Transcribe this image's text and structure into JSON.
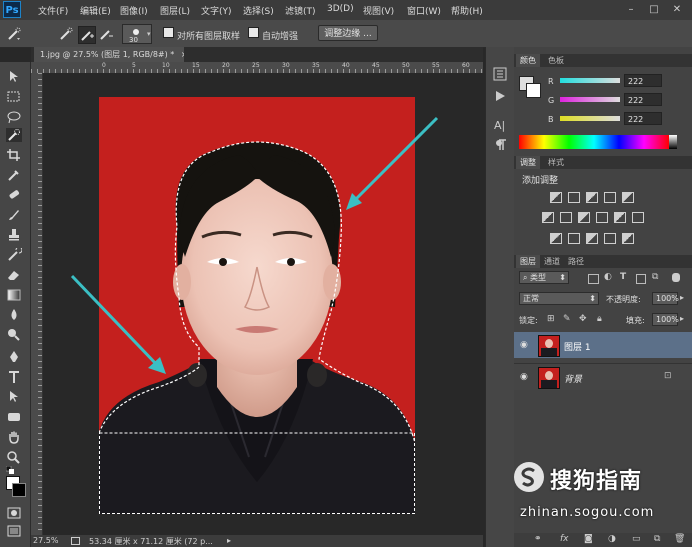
{
  "app": {
    "logo": "Ps",
    "menu": [
      "文件(F)",
      "编辑(E)",
      "图像(I)",
      "图层(L)",
      "文字(Y)",
      "选择(S)",
      "滤镜(T)",
      "3D(D)",
      "视图(V)",
      "窗口(W)",
      "帮助(H)"
    ],
    "window_controls": [
      "–",
      "□",
      "✕"
    ]
  },
  "options_bar": {
    "brush_size": "30",
    "sample_all_layers": "对所有图层取样",
    "auto_enhance": "自动增强",
    "refine_edge": "调整边缘 ..."
  },
  "document": {
    "tab_title": "1.jpg @ 27.5% (图层 1, RGB/8#) *",
    "tab_close": "×",
    "ruler_top_ticks": [
      "0",
      "5",
      "10",
      "15",
      "20",
      "25",
      "30",
      "35",
      "40",
      "45",
      "50",
      "55",
      "60"
    ],
    "zoom": "27.5%",
    "doc_info": "53.34 厘米 x 71.12 厘米 (72 p..."
  },
  "color_panel": {
    "tabs": [
      "颜色",
      "色板"
    ],
    "channels": [
      {
        "label": "R",
        "value": "222"
      },
      {
        "label": "G",
        "value": "222"
      },
      {
        "label": "B",
        "value": "222"
      }
    ],
    "foreground": "#dedede",
    "background": "#ffffff"
  },
  "adjustments_panel": {
    "tabs": [
      "调整",
      "样式"
    ],
    "title": "添加调整"
  },
  "layers_panel": {
    "tabs": [
      "图层",
      "通道",
      "路径"
    ],
    "filter_kind": "类型",
    "blend_mode": "正常",
    "opacity_label": "不透明度:",
    "opacity_value": "100%",
    "lock_label": "锁定:",
    "fill_label": "填充:",
    "fill_value": "100%",
    "layers": [
      {
        "name": "图层 1",
        "selected": true,
        "locked": false
      },
      {
        "name": "背景",
        "selected": false,
        "locked": true
      }
    ]
  },
  "watermark": {
    "text": "搜狗指南",
    "url": "zhinan.sogou.com"
  },
  "colors": {
    "photo_background": "#c4201e",
    "annotation_arrow": "#3bbfc4",
    "ps_blue": "#31a8ff"
  }
}
